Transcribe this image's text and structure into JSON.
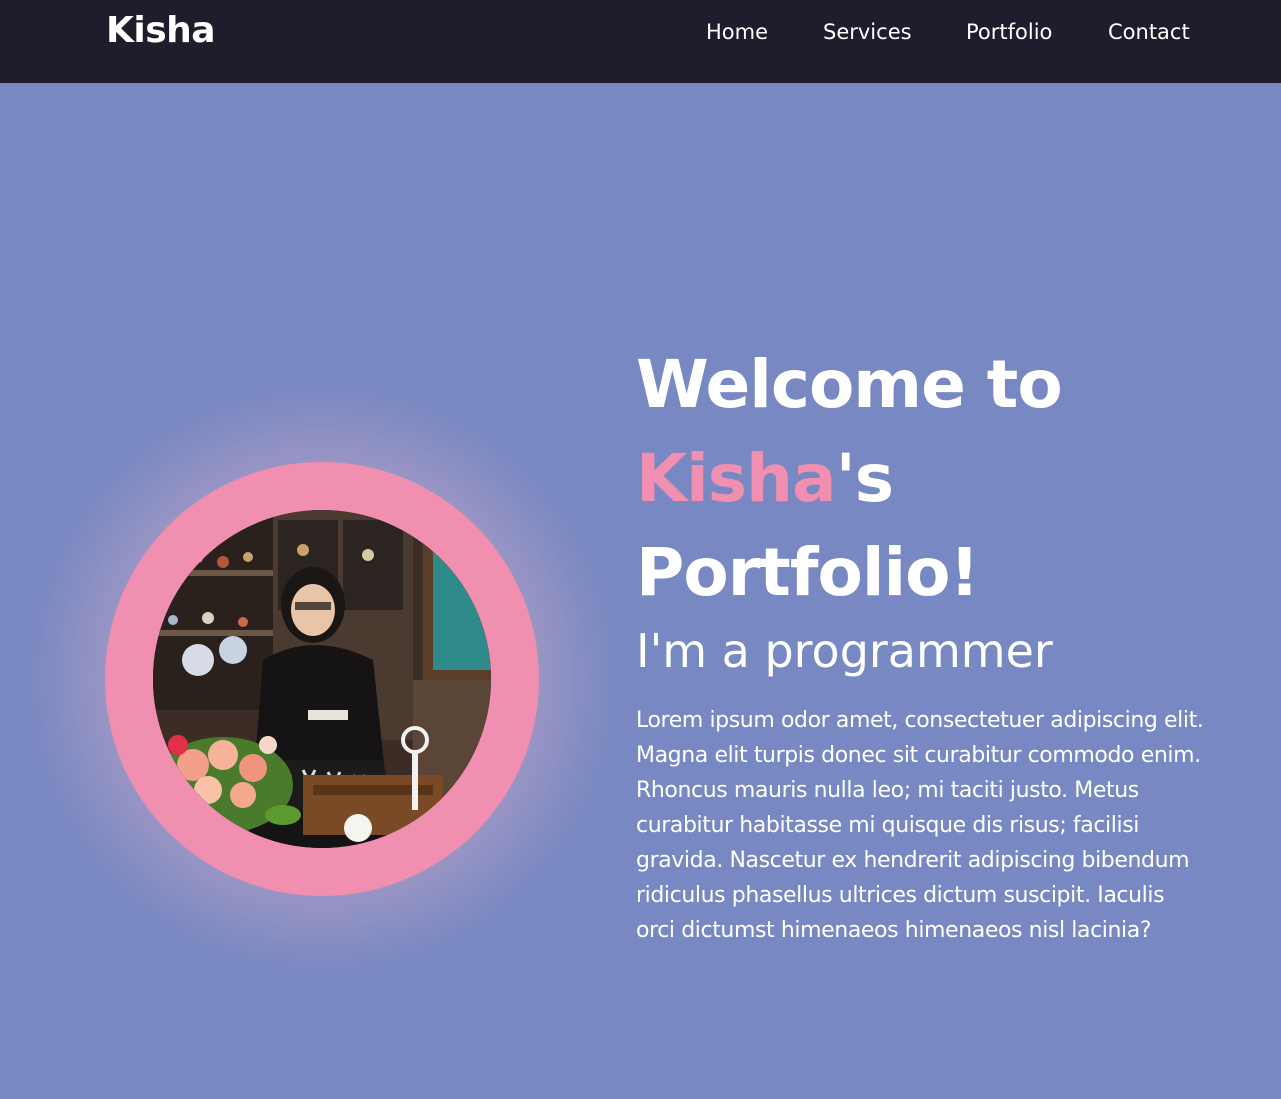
{
  "nav": {
    "logo": "Kisha",
    "links": [
      "Home",
      "Services",
      "Portfolio",
      "Contact"
    ]
  },
  "hero": {
    "title_prefix": "Welcome to",
    "title_name": "Kisha",
    "title_possessive": "'s",
    "title_suffix": "Portfolio!",
    "subtitle": "I'm a programmer",
    "description": "Lorem ipsum odor amet, consectetuer adipiscing elit. Magna elit turpis donec sit curabitur commodo enim. Rhoncus mauris nulla leo; mi taciti justo. Metus curabitur habitasse mi quisque dis risus; facilisi gravida. Nascetur ex hendrerit adipiscing bibendum ridiculus phasellus ultrices dictum suscipit. Iaculis orci dictumst himenaeos himenaeos nisl lacinia?"
  },
  "colors": {
    "navbar_bg": "#1f1d2b",
    "page_bg": "#7888c2",
    "accent_pink": "#f08fb0",
    "text": "#ffffff"
  }
}
